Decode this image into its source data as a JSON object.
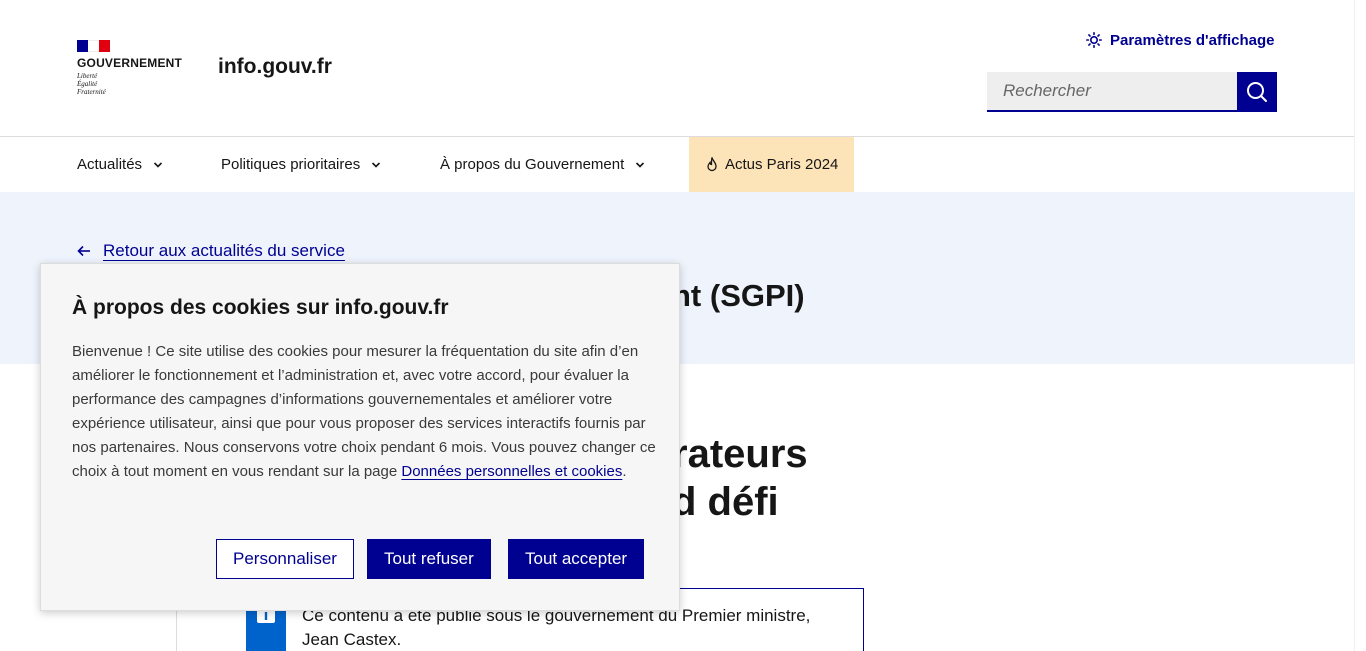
{
  "header": {
    "logo_title": "GOUVERNEMENT",
    "motto": [
      "Liberté",
      "Égalité",
      "Fraternité"
    ],
    "site_name": "info.gouv.fr",
    "display_settings_label": "Paramètres d'affichage",
    "search_placeholder": "Rechercher"
  },
  "nav": {
    "items": [
      {
        "label": "Actualités"
      },
      {
        "label": "Politiques prioritaires"
      },
      {
        "label": "À propos du Gouvernement"
      },
      {
        "label": "Actus Paris 2024"
      }
    ]
  },
  "hero": {
    "back_link": "Retour aux actualités du service",
    "title_visible": "nt (SGPI)"
  },
  "article": {
    "title_line1": "rateurs",
    "title_line2": "d défi",
    "notice_text": "Ce contenu a été publié sous le gouvernement du Premier ministre, Jean Castex."
  },
  "cookie": {
    "title": "À propos des cookies sur info.gouv.fr",
    "body": "Bienvenue ! Ce site utilise des cookies pour mesurer la fréquentation du site afin d’en améliorer le fonctionnement et l’administration et, avec votre accord, pour évaluer la performance des campagnes d’informations gouvernementales et améliorer votre expérience utilisateur, ainsi que pour vous proposer des services interactifs fournis par nos partenaires. Nous conservons votre choix pendant 6 mois. Vous pouvez changer ce choix à tout moment en vous rendant sur la page ",
    "link": "Données personnelles et cookies",
    "period": ".",
    "customize_label": "Personnaliser",
    "refuse_label": "Tout refuser",
    "accept_label": "Tout accepter"
  },
  "colors": {
    "primary": "#000091",
    "flag_blue": "#000091",
    "flag_white": "#ffffff",
    "flag_red": "#e1000f",
    "hero_bg": "#eef3fc",
    "highlight_bg": "#fde4b8",
    "info_blue": "#0063cb"
  },
  "icons": {
    "display": "sun-icon",
    "search": "search-icon",
    "nav_chevron": "chevron-down-icon",
    "paris": "flame-icon",
    "back": "arrow-left-icon",
    "notice": "info-icon"
  }
}
